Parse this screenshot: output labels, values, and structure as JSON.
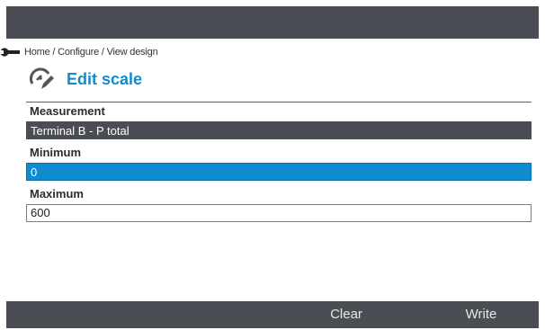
{
  "breadcrumb": {
    "icon": "wrench-icon",
    "text": "Home / Configure / View design"
  },
  "page": {
    "icon": "gauge-edit-icon",
    "title": "Edit scale"
  },
  "form": {
    "measurement": {
      "label": "Measurement",
      "value": "Terminal B - P total"
    },
    "minimum": {
      "label": "Minimum",
      "value": "0"
    },
    "maximum": {
      "label": "Maximum",
      "value": "600"
    }
  },
  "softkeys": {
    "clear": "Clear",
    "write": "Write"
  },
  "colors": {
    "bar": "#4a4d53",
    "accent": "#0f8bcf"
  }
}
